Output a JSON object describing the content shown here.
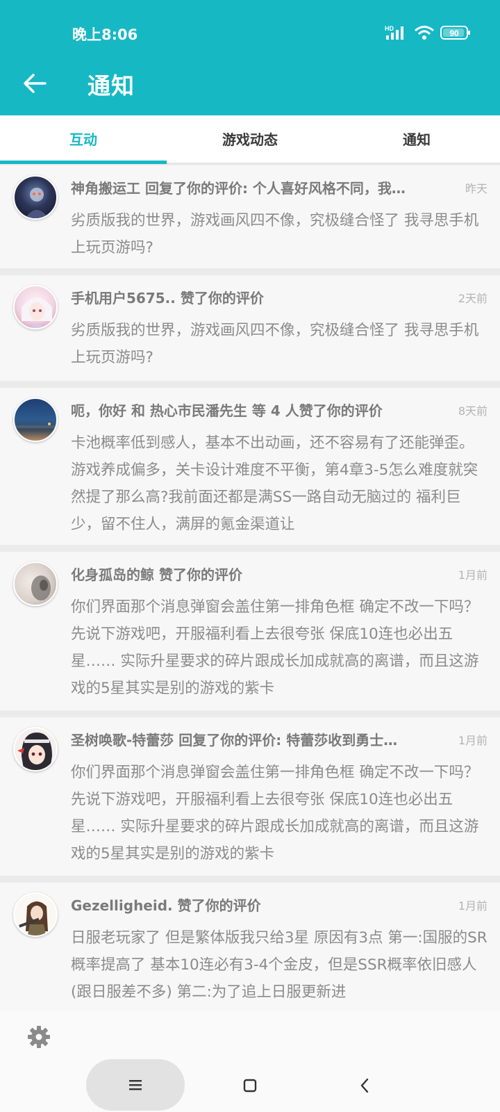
{
  "status_bar": {
    "time": "晚上8:06",
    "network_label": "HD",
    "battery_level": "90"
  },
  "app_bar": {
    "title": "通知",
    "accent_color": "#16b8c4"
  },
  "tabs": [
    {
      "label": "互动",
      "active": true
    },
    {
      "label": "游戏动态",
      "active": false
    },
    {
      "label": "通知",
      "active": false
    }
  ],
  "notifications": [
    {
      "header": "神角搬运工 回复了你的评价: 个人喜好风格不同，我…",
      "time": "昨天",
      "body": "劣质版我的世界，游戏画风四不像，究极缝合怪了 我寻思手机上玩页游吗?"
    },
    {
      "header": "手机用户5675.. 赞了你的评价",
      "time": "2天前",
      "body": "劣质版我的世界，游戏画风四不像，究极缝合怪了 我寻思手机上玩页游吗?"
    },
    {
      "header": "呃，你好 和 热心市民潘先生 等 4 人赞了你的评价",
      "time": "8天前",
      "body": "卡池概率低到感人，基本不出动画，还不容易有了还能弹歪。游戏养成偏多，关卡设计难度不平衡，第4章3-5怎么难度就突然提了那么高?我前面还都是满SS一路自动无脑过的 福利巨少，留不住人，满屏的氪金渠道让"
    },
    {
      "header": "化身孤岛的鲸 赞了你的评价",
      "time": "1月前",
      "body": "你们界面那个消息弹窗会盖住第一排角色框 确定不改一下吗？ 先说下游戏吧，开服福利看上去很夸张 保底10连也必出五星…… 实际升星要求的碎片跟成长加成就高的离谱，而且这游戏的5星其实是别的游戏的紫卡"
    },
    {
      "header": "圣树唤歌-特蕾莎 回复了你的评价: 特蕾莎收到勇士…",
      "time": "1月前",
      "body": "你们界面那个消息弹窗会盖住第一排角色框 确定不改一下吗？ 先说下游戏吧，开服福利看上去很夸张 保底10连也必出五星…… 实际升星要求的碎片跟成长加成就高的离谱，而且这游戏的5星其实是别的游戏的紫卡"
    },
    {
      "header": "Gezelligheid. 赞了你的评价",
      "time": "1月前",
      "body": "日服老玩家了 但是繁体版我只给3星 原因有3点 第一:国服的SR概率提高了 基本10连必有3-4个金皮，但是SSR概率依旧感人(跟日服差不多) 第二:为了追上日服更新进"
    }
  ],
  "footer": {
    "settings_icon": "gear-icon"
  },
  "nav_bar": {
    "menu_icon": "menu-icon",
    "home_icon": "home-icon",
    "back_icon": "back-icon"
  }
}
